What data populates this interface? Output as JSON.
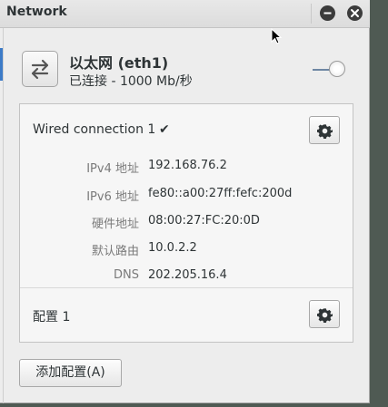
{
  "window": {
    "title": "Network",
    "minimize_icon": "minimize-icon",
    "close_icon": "close-icon"
  },
  "device": {
    "icon": "network-transfer-arrows-icon",
    "name": "以太网 (eth1)",
    "status": "已连接 - 1000 Mb/秒",
    "switch_on": true
  },
  "connection": {
    "name": "Wired connection 1",
    "active_check": "✔",
    "details": [
      {
        "label": "IPv4 地址",
        "value": "192.168.76.2"
      },
      {
        "label": "IPv6 地址",
        "value": "fe80::a00:27ff:fefc:200d"
      },
      {
        "label": "硬件地址",
        "value": "08:00:27:FC:20:0D"
      },
      {
        "label": "默认路由",
        "value": "10.0.2.2"
      },
      {
        "label": "DNS",
        "value": "202.205.16.4"
      }
    ]
  },
  "profile": {
    "name": "配置 1"
  },
  "actions": {
    "add_profile_label": "添加配置(A)"
  },
  "colors": {
    "selection_accent": "#3c7bc7",
    "desktop_background": "#4f5a53"
  }
}
